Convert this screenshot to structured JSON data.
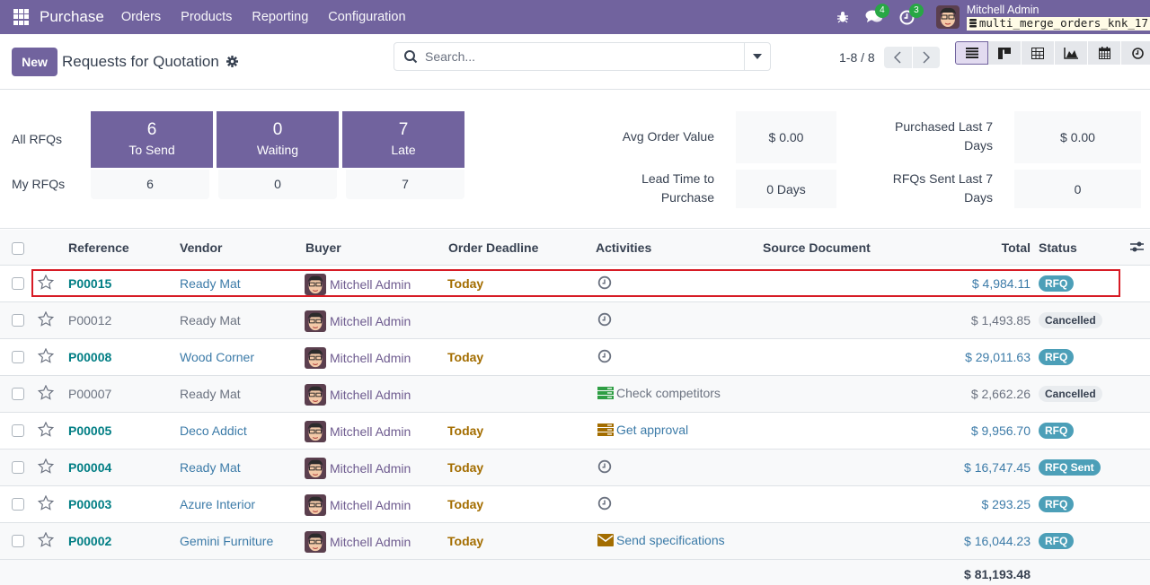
{
  "navbar": {
    "app_name": "Purchase",
    "menu": [
      "Orders",
      "Products",
      "Reporting",
      "Configuration"
    ],
    "messages_count": "4",
    "activities_count": "3",
    "user_name": "Mitchell Admin",
    "database": "multi_merge_orders_knk_17"
  },
  "control": {
    "new_label": "New",
    "title": "Requests for Quotation",
    "search_placeholder": "Search...",
    "pager": "1-8 / 8",
    "views": [
      "list-view",
      "kanban-view",
      "pivot-view",
      "graph-view",
      "calendar-view",
      "activity-view"
    ],
    "active_view": "list-view"
  },
  "dashboard": {
    "all_label": "All RFQs",
    "my_label": "My RFQs",
    "tiles": [
      {
        "count": "6",
        "label": "To Send",
        "my": "6"
      },
      {
        "count": "0",
        "label": "Waiting",
        "my": "0"
      },
      {
        "count": "7",
        "label": "Late",
        "my": "7"
      }
    ],
    "stats": {
      "avg_order_label": "Avg Order Value",
      "avg_order_value": "$ 0.00",
      "lead_time_label": "Lead Time to Purchase",
      "lead_time_value": "0 Days",
      "purchased_label": "Purchased Last 7 Days",
      "purchased_value": "$ 0.00",
      "rfqs_sent_label": "RFQs Sent Last 7 Days",
      "rfqs_sent_value": "0"
    }
  },
  "table": {
    "columns": [
      "Reference",
      "Vendor",
      "Buyer",
      "Order Deadline",
      "Activities",
      "Source Document",
      "Total",
      "Status"
    ],
    "rows": [
      {
        "ref": "P00015",
        "vendor": "Ready Mat",
        "buyer": "Mitchell Admin",
        "deadline": "Today",
        "activity_icon": "clock-icon",
        "activity": "",
        "source": "",
        "total": "$ 4,984.11",
        "status": "RFQ",
        "state": "rfq"
      },
      {
        "ref": "P00012",
        "vendor": "Ready Mat",
        "buyer": "Mitchell Admin",
        "deadline": "",
        "activity_icon": "clock-icon",
        "activity": "",
        "source": "",
        "total": "$ 1,493.85",
        "status": "Cancelled",
        "state": "cancel"
      },
      {
        "ref": "P00008",
        "vendor": "Wood Corner",
        "buyer": "Mitchell Admin",
        "deadline": "Today",
        "activity_icon": "clock-icon",
        "activity": "",
        "source": "",
        "total": "$ 29,011.63",
        "status": "RFQ",
        "state": "rfq"
      },
      {
        "ref": "P00007",
        "vendor": "Ready Mat",
        "buyer": "Mitchell Admin",
        "deadline": "",
        "activity_icon": "tasks-icon-green",
        "activity": "Check competitors",
        "source": "",
        "total": "$ 2,662.26",
        "status": "Cancelled",
        "state": "cancel"
      },
      {
        "ref": "P00005",
        "vendor": "Deco Addict",
        "buyer": "Mitchell Admin",
        "deadline": "Today",
        "activity_icon": "tasks-icon-amber",
        "activity": "Get approval",
        "source": "",
        "total": "$ 9,956.70",
        "status": "RFQ",
        "state": "rfq"
      },
      {
        "ref": "P00004",
        "vendor": "Ready Mat",
        "buyer": "Mitchell Admin",
        "deadline": "Today",
        "activity_icon": "clock-icon",
        "activity": "",
        "source": "",
        "total": "$ 16,747.45",
        "status": "RFQ Sent",
        "state": "sent"
      },
      {
        "ref": "P00003",
        "vendor": "Azure Interior",
        "buyer": "Mitchell Admin",
        "deadline": "Today",
        "activity_icon": "clock-icon",
        "activity": "",
        "source": "",
        "total": "$ 293.25",
        "status": "RFQ",
        "state": "rfq"
      },
      {
        "ref": "P00002",
        "vendor": "Gemini Furniture",
        "buyer": "Mitchell Admin",
        "deadline": "Today",
        "activity_icon": "envelope-icon",
        "activity": "Send specifications",
        "source": "",
        "total": "$ 16,044.23",
        "status": "RFQ",
        "state": "rfq"
      }
    ],
    "grand_total": "$ 81,193.48"
  },
  "colors": {
    "brand": "#71639e",
    "link": "#3c7ba8",
    "reference": "#017e84",
    "deadline": "#a36d00",
    "status_rfq": "#4c9fb8",
    "highlight": "#d71b25"
  }
}
